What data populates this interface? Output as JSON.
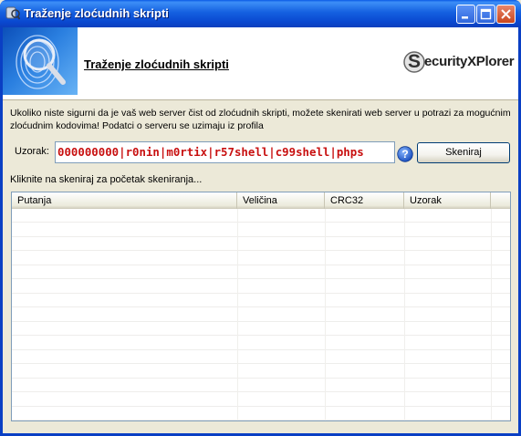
{
  "window": {
    "title": "Traženje zloćudnih skripti"
  },
  "banner": {
    "title": "Traženje zloćudnih skripti",
    "brand": "ecurityXPlorer",
    "brand_initial": "S"
  },
  "description": "Ukoliko niste sigurni da je vaš web server čist od zloćudnih skripti, možete skenirati web server u potrazi za mogućnim zloćudnim kodovima! Podatci o serveru se uzimaju iz profila",
  "search": {
    "label": "Uzorak:",
    "value": "000000000|r0nin|m0rtix|r57shell|c99shell|phps",
    "button_label": "Skeniraj"
  },
  "status_text": "Kliknite na skeniraj za početak skeniranja...",
  "results_table": {
    "columns": [
      "Putanja",
      "Veličina",
      "CRC32",
      "Uzorak"
    ],
    "rows": []
  },
  "colors": {
    "titlebar": "#0a5ae6",
    "pattern_text": "#c81010",
    "face": "#ece9d8"
  },
  "icons": {
    "app": "app-icon",
    "help": "help-icon",
    "banner": "fingerprint-magnifier-icon"
  }
}
